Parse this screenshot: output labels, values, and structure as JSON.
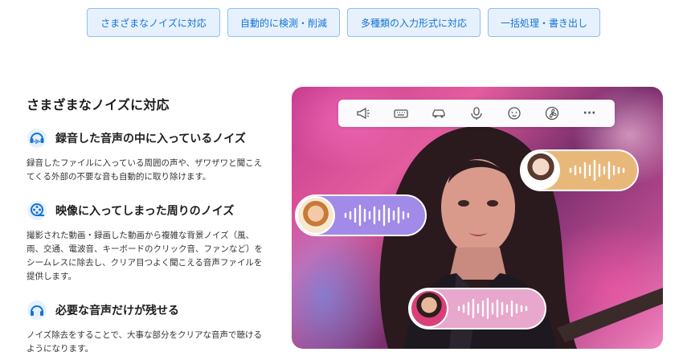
{
  "tabs": [
    {
      "label": "さまざまなノイズに対応"
    },
    {
      "label": "自動的に検測・削減"
    },
    {
      "label": "多種類の入力形式に対応"
    },
    {
      "label": "一括処理・書き出し"
    }
  ],
  "main": {
    "heading": "さまざまなノイズに対応",
    "features": [
      {
        "icon": "headset-wave-icon",
        "title": "録音した音声の中に入っているノイズ",
        "desc": "録音したファイルに入っている周囲の声や、ザワザワと聞こえてくる外部の不要な音も自動的に取り除けます。"
      },
      {
        "icon": "film-reel-icon",
        "title": "映像に入ってしまった周りのノイズ",
        "desc": "撮影された動画・録画した動画から複雑な背景ノイズ（風、雨、交通、電波音、キーボードのクリック音、ファンなど）をシームレスに除去し、クリア目つよく聞こえる音声ファイルを提供します。"
      },
      {
        "icon": "headphones-icon",
        "title": "必要な音声だけが残せる",
        "desc": "ノイズ除去をすることで、大事な部分をクリアな音声で聴けるようになります。"
      }
    ]
  },
  "hero": {
    "toolbar_icons": [
      "megaphone-icon",
      "keyboard-icon",
      "car-icon",
      "microphone-icon",
      "baby-face-icon",
      "fan-icon",
      "more-icon"
    ],
    "more_label": "···",
    "colors": {
      "accent": "#1473d6",
      "pill_orange": "#e8b87b",
      "pill_purple": "#a18ae8",
      "pill_pink": "#e8a7cc"
    }
  }
}
